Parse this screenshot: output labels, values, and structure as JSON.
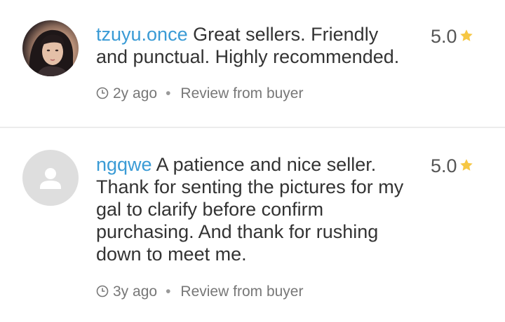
{
  "reviews": [
    {
      "username": "tzuyu.once",
      "text": "Great sellers.  Friendly and punctual. Highly recommended.",
      "rating": "5.0",
      "time": "2y ago",
      "source": "Review from buyer",
      "avatar": "profile-photo"
    },
    {
      "username": "ngqwe",
      "text": "A patience and nice seller. Thank for senting the pictures for my gal to clarify before confirm purchasing. And thank for rushing down to meet me.",
      "rating": "5.0",
      "time": "3y ago",
      "source": "Review from buyer",
      "avatar": "default-user-icon"
    }
  ],
  "colors": {
    "username": "#3a9bd5",
    "star": "#f6c744",
    "text": "#333333",
    "meta": "#777777"
  },
  "icons": {
    "rating": "star-icon",
    "time": "clock-icon"
  }
}
